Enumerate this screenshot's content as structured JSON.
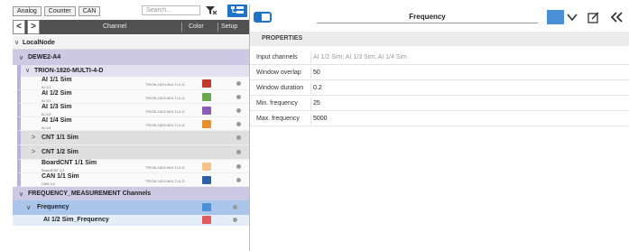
{
  "filter": {
    "tabs": [
      "Analog",
      "Counter",
      "CAN"
    ],
    "search_placeholder": "Search..."
  },
  "tree_header": {
    "back": "<",
    "forward": ">",
    "channel": "Channel",
    "color": "Color",
    "setup": "Setup"
  },
  "tree": {
    "local_node": "LocalNode",
    "device": "DEWE2-A4",
    "module": "TRION-1820-MULTI-4-D",
    "channels": [
      {
        "name": "AI 1/1 Sim",
        "sub": "AI 1/1",
        "device": "TRION-1820-MULTI-4-D",
        "color": "#c0392b"
      },
      {
        "name": "AI 1/2 Sim",
        "sub": "AI 1/2",
        "device": "TRION-1820-MULTI-4-D",
        "color": "#6aa84f"
      },
      {
        "name": "AI 1/3 Sim",
        "sub": "AI 1/3",
        "device": "TRION-1820-MULTI-4-D",
        "color": "#8e5bb5"
      },
      {
        "name": "AI 1/4 Sim",
        "sub": "AI 1/4",
        "device": "TRION-1820-MULTI-4-D",
        "color": "#e6912f"
      }
    ],
    "cnt_groups": [
      "CNT 1/1 Sim",
      "CNT 1/2 Sim"
    ],
    "board_cnt": {
      "name": "BoardCNT 1/1 Sim",
      "sub": "BoardCNT 1/1",
      "device": "TRION-1820-MULTI-4-D",
      "color": "#f4c48a"
    },
    "can": {
      "name": "CAN 1/1 Sim",
      "sub": "CAN 1/1",
      "device": "TRION-1820-MULTI-4-D",
      "color": "#2e5fa8"
    },
    "freq_group": "FREQUENCY_MEASUREMENT Channels",
    "freq": {
      "name": "Frequency",
      "color": "#4a90d9"
    },
    "freq_child": {
      "name": "AI 1/2 Sim_Frequency",
      "color": "#e05c5c"
    }
  },
  "detail": {
    "channel_name": "Frequency",
    "color": "#4a90d9",
    "section": "PROPERTIES",
    "properties": [
      {
        "label": "Input channels",
        "value": "AI 1/2 Sim; AI 1/3 Sim; AI 1/4 Sim"
      },
      {
        "label": "Window overlap",
        "value": "50"
      },
      {
        "label": "Window duration",
        "value": "0.2"
      },
      {
        "label": "Min. frequency",
        "value": "25"
      },
      {
        "label": "Max. frequency",
        "value": "5000"
      }
    ]
  }
}
